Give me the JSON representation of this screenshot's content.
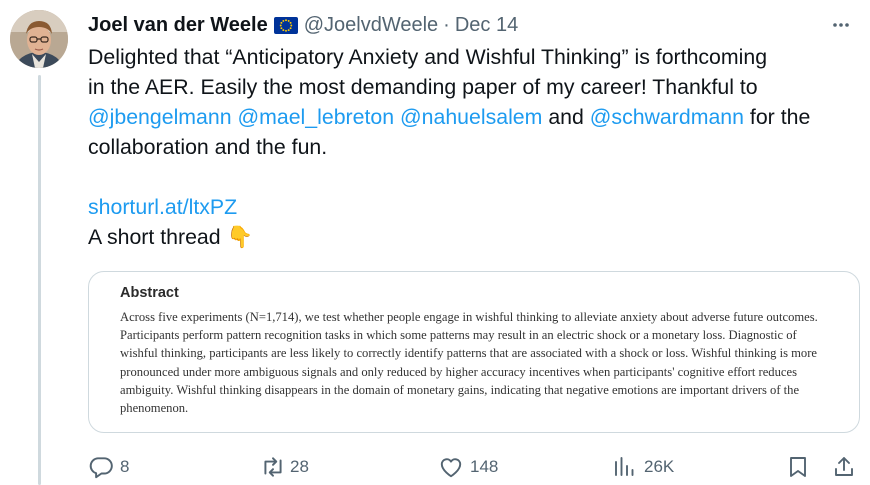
{
  "tweet": {
    "author_name": "Joel van der Weele",
    "handle": "@JoelvdWeele",
    "separator": "·",
    "date": "Dec 14",
    "body": {
      "line1_pre": "Delighted that “Anticipatory Anxiety and Wishful Thinking” is forthcoming",
      "line2": "in the AER. Easily the most demanding paper of my career! Thankful to",
      "mentions": [
        "@jbengelmann",
        "@mael_lebreton",
        "@nahuelsalem",
        "@schwardmann"
      ],
      "and_word": "and",
      "line3_tail": "for the",
      "line4": "collaboration and the fun.",
      "link": "shorturl.at/ltxPZ",
      "thread_label": "A short thread",
      "emoji": "👇"
    },
    "attachment": {
      "title": "Abstract",
      "text": "Across five experiments (N=1,714), we test whether people engage in wishful thinking to alleviate anxiety about adverse future outcomes. Participants perform pattern recognition tasks in which some patterns may result in an electric shock or a monetary loss. Diagnostic of wishful thinking, participants are less likely to correctly identify patterns that are associated with a shock or loss. Wishful thinking is more pronounced under more ambiguous signals and only reduced by higher accuracy incentives when participants' cognitive effort reduces ambiguity. Wishful thinking disappears in the domain of monetary gains, indicating that negative emotions are important drivers of the phenomenon."
    },
    "metrics": {
      "replies": "8",
      "retweets": "28",
      "likes": "148",
      "views": "26K"
    }
  },
  "colors": {
    "text": "#0f1419",
    "secondary": "#536471",
    "link": "#1d9bf0",
    "border": "#cfd9de",
    "eu_flag_blue": "#003399",
    "eu_flag_star": "#ffcc00"
  },
  "icons": [
    "avatar-photo",
    "eu-flag-icon",
    "more-icon",
    "reply-icon",
    "retweet-icon",
    "like-icon",
    "views-icon",
    "bookmark-icon",
    "share-icon",
    "backhand-index-down-emoji"
  ]
}
